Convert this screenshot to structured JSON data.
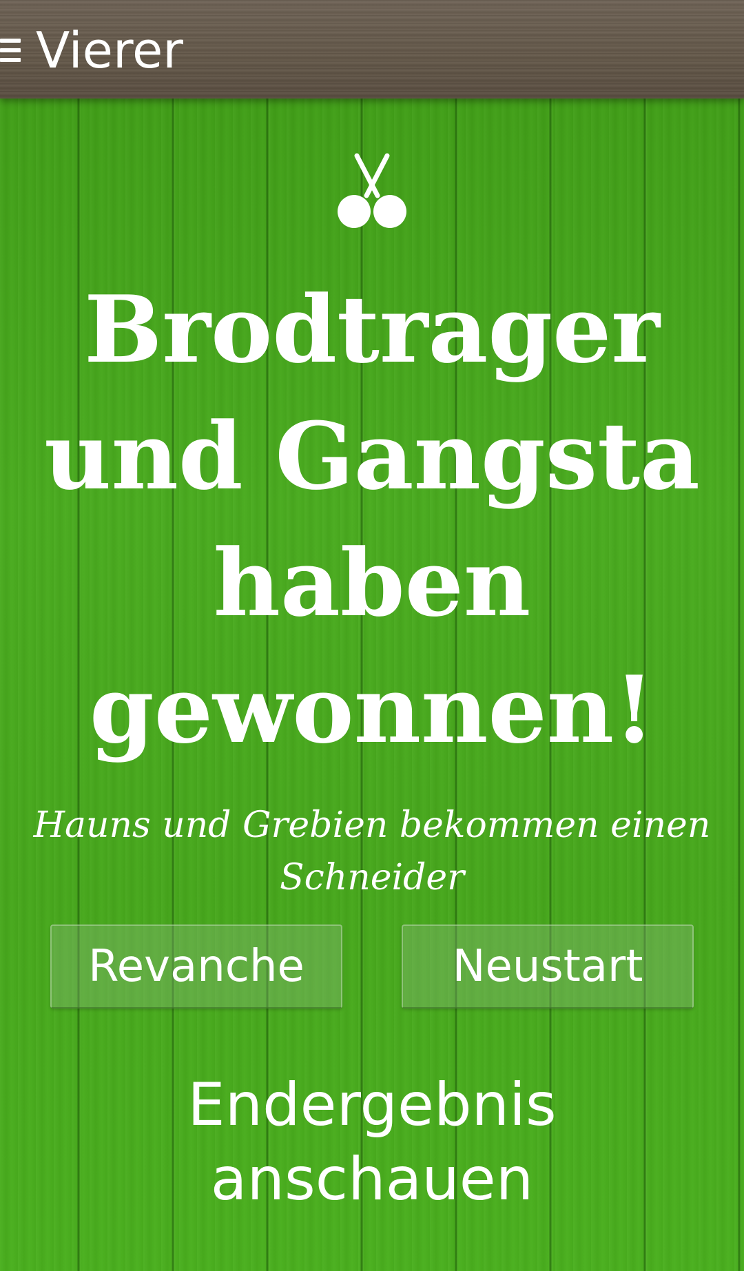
{
  "action_bar": {
    "title": "Vierer",
    "menu_icon": "hamburger-menu-icon"
  },
  "result": {
    "icon": "cherry-scissors-icon",
    "headline": "Brodtrager und Gangsta haben gewonnen!",
    "subline": "Hauns und Grebien bekommen einen Schneider"
  },
  "buttons": {
    "revanche_label": "Revanche",
    "neustart_label": "Neustart"
  },
  "links": {
    "endergebnis_label": "Endergebnis anschauen"
  },
  "colors": {
    "background": "#44a51a",
    "action_bar": "#6b5f52",
    "text": "#ffffff"
  }
}
